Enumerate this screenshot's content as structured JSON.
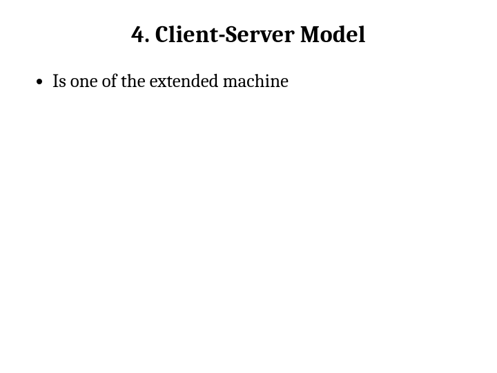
{
  "slide": {
    "title": "4. Client-Server Model",
    "bullets": [
      {
        "text": "Is one of the extended machine"
      }
    ]
  }
}
